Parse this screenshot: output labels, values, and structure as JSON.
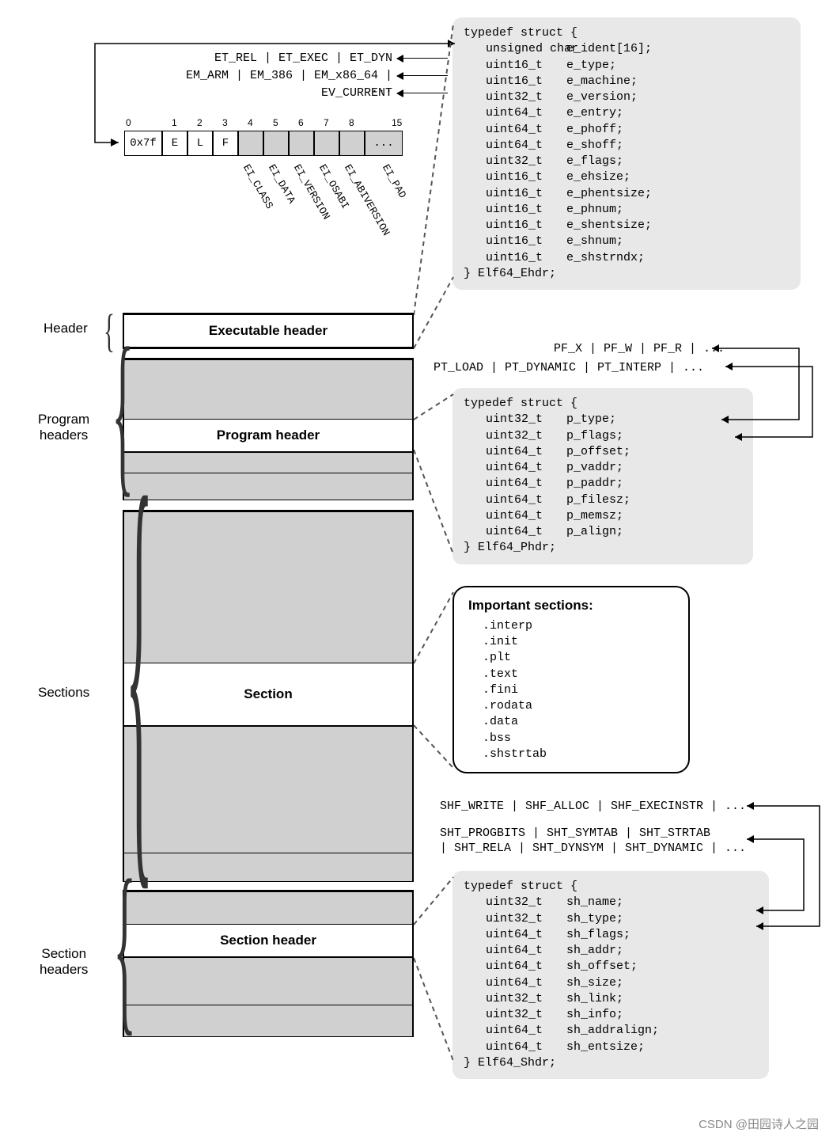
{
  "labels": {
    "header": "Header",
    "program_headers": "Program\nheaders",
    "sections": "Sections",
    "section_headers": "Section\nheaders"
  },
  "blocks": {
    "exec_header": "Executable header",
    "program_header": "Program header",
    "section": "Section",
    "section_header": "Section header"
  },
  "ehdr": {
    "open": "typedef struct {",
    "fields": [
      {
        "t": "unsigned char",
        "n": "e_ident[16];"
      },
      {
        "t": "uint16_t",
        "n": "e_type;"
      },
      {
        "t": "uint16_t",
        "n": "e_machine;"
      },
      {
        "t": "uint32_t",
        "n": "e_version;"
      },
      {
        "t": "uint64_t",
        "n": "e_entry;"
      },
      {
        "t": "uint64_t",
        "n": "e_phoff;"
      },
      {
        "t": "uint64_t",
        "n": "e_shoff;"
      },
      {
        "t": "uint32_t",
        "n": "e_flags;"
      },
      {
        "t": "uint16_t",
        "n": "e_ehsize;"
      },
      {
        "t": "uint16_t",
        "n": "e_phentsize;"
      },
      {
        "t": "uint16_t",
        "n": "e_phnum;"
      },
      {
        "t": "uint16_t",
        "n": "e_shentsize;"
      },
      {
        "t": "uint16_t",
        "n": "e_shnum;"
      },
      {
        "t": "uint16_t",
        "n": "e_shstrndx;"
      }
    ],
    "close": "} Elf64_Ehdr;"
  },
  "phdr": {
    "open": "typedef struct {",
    "fields": [
      {
        "t": "uint32_t",
        "n": "p_type;"
      },
      {
        "t": "uint32_t",
        "n": "p_flags;"
      },
      {
        "t": "uint64_t",
        "n": "p_offset;"
      },
      {
        "t": "uint64_t",
        "n": "p_vaddr;"
      },
      {
        "t": "uint64_t",
        "n": "p_paddr;"
      },
      {
        "t": "uint64_t",
        "n": "p_filesz;"
      },
      {
        "t": "uint64_t",
        "n": "p_memsz;"
      },
      {
        "t": "uint64_t",
        "n": "p_align;"
      }
    ],
    "close": "} Elf64_Phdr;"
  },
  "shdr": {
    "open": "typedef struct {",
    "fields": [
      {
        "t": "uint32_t",
        "n": "sh_name;"
      },
      {
        "t": "uint32_t",
        "n": "sh_type;"
      },
      {
        "t": "uint64_t",
        "n": "sh_flags;"
      },
      {
        "t": "uint64_t",
        "n": "sh_addr;"
      },
      {
        "t": "uint64_t",
        "n": "sh_offset;"
      },
      {
        "t": "uint64_t",
        "n": "sh_size;"
      },
      {
        "t": "uint32_t",
        "n": "sh_link;"
      },
      {
        "t": "uint32_t",
        "n": "sh_info;"
      },
      {
        "t": "uint64_t",
        "n": "sh_addralign;"
      },
      {
        "t": "uint64_t",
        "n": "sh_entsize;"
      }
    ],
    "close": "} Elf64_Shdr;"
  },
  "sections_box": {
    "title": "Important sections:",
    "items": [
      ".interp",
      ".init",
      ".plt",
      ".text",
      ".fini",
      ".rodata",
      ".data",
      ".bss",
      ".shstrtab"
    ]
  },
  "annots": {
    "e_type": "ET_REL | ET_EXEC | ET_DYN",
    "e_machine": "EM_ARM | EM_386 | EM_x86_64 | ...",
    "e_version": "EV_CURRENT",
    "p_flags": "PF_X | PF_W | PF_R | ...",
    "p_type": "PT_LOAD | PT_DYNAMIC | PT_INTERP | ...",
    "sh_flags": "SHF_WRITE | SHF_ALLOC | SHF_EXECINSTR | ...",
    "sh_type_l1": "SHT_PROGBITS | SHT_SYMTAB | SHT_STRTAB",
    "sh_type_l2": "| SHT_RELA | SHT_DYNSYM | SHT_DYNAMIC | ..."
  },
  "eident": {
    "bytes": [
      "0x7f",
      "E",
      "L",
      "F",
      "",
      "",
      "",
      "",
      "",
      "..."
    ],
    "indices": {
      "0": "0",
      "1": "1",
      "2": "2",
      "3": "3",
      "4": "4",
      "5": "5",
      "6": "6",
      "7": "7",
      "8": "8",
      "9": "15"
    },
    "labels": [
      "EI_CLASS",
      "EI_DATA",
      "EI_VERSION",
      "EI_OSABI",
      "EI_ABIVERSION",
      "EI_PAD"
    ]
  },
  "watermark": "CSDN @田园诗人之园"
}
